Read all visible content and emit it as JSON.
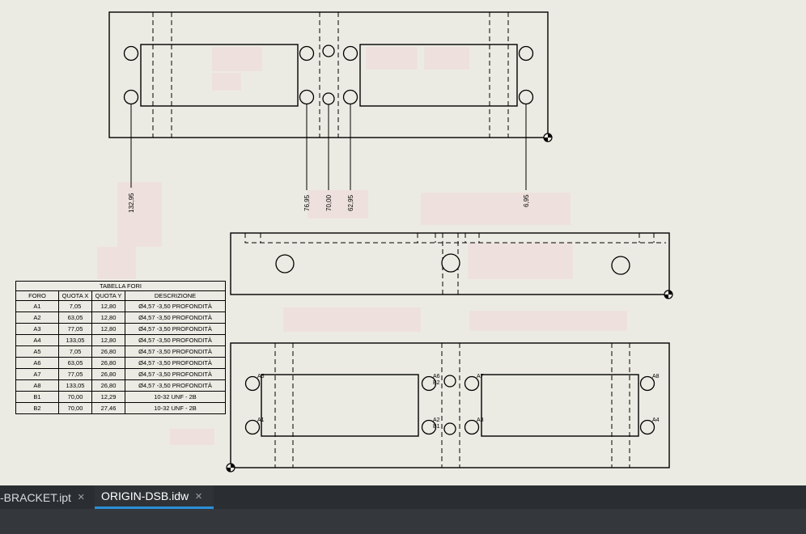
{
  "tabs": [
    {
      "label": "-BRACKET.ipt",
      "active": false
    },
    {
      "label": "ORIGIN-DSB.idw",
      "active": true
    }
  ],
  "close_icon": "×",
  "dimensions": [
    "132,95",
    "76,95",
    "70,00",
    "62,95",
    "6,95"
  ],
  "hole_tags": {
    "a5": "A5",
    "a6": "A6",
    "b2": "B2",
    "a7": "A7",
    "a8": "A8",
    "a1": "A1",
    "a2": "A2",
    "b1": "B1",
    "a3": "A3",
    "a4": "A4"
  },
  "hole_table": {
    "title": "TABELLA FORI",
    "headers": [
      "FORO",
      "QUOTA X",
      "QUOTA Y",
      "DESCRIZIONE"
    ],
    "rows": [
      [
        "A1",
        "7,05",
        "12,80",
        "Ø4,57 -3,50 PROFONDITÀ"
      ],
      [
        "A2",
        "63,05",
        "12,80",
        "Ø4,57 -3,50 PROFONDITÀ"
      ],
      [
        "A3",
        "77,05",
        "12,80",
        "Ø4,57 -3,50 PROFONDITÀ"
      ],
      [
        "A4",
        "133,05",
        "12,80",
        "Ø4,57 -3,50 PROFONDITÀ"
      ],
      [
        "A5",
        "7,05",
        "26,80",
        "Ø4,57 -3,50 PROFONDITÀ"
      ],
      [
        "A6",
        "63,05",
        "26,80",
        "Ø4,57 -3,50 PROFONDITÀ"
      ],
      [
        "A7",
        "77,05",
        "26,80",
        "Ø4,57 -3,50 PROFONDITÀ"
      ],
      [
        "A8",
        "133,05",
        "26,80",
        "Ø4,57 -3,50 PROFONDITÀ"
      ],
      [
        "B1",
        "70,00",
        "12,29",
        "10-32 UNF - 2B"
      ],
      [
        "B2",
        "70,00",
        "27,46",
        "10-32 UNF - 2B"
      ]
    ]
  },
  "colors": {
    "paper": "#ecebe3",
    "tabbar": "#2a2e33",
    "accent": "#2b8fd6"
  }
}
